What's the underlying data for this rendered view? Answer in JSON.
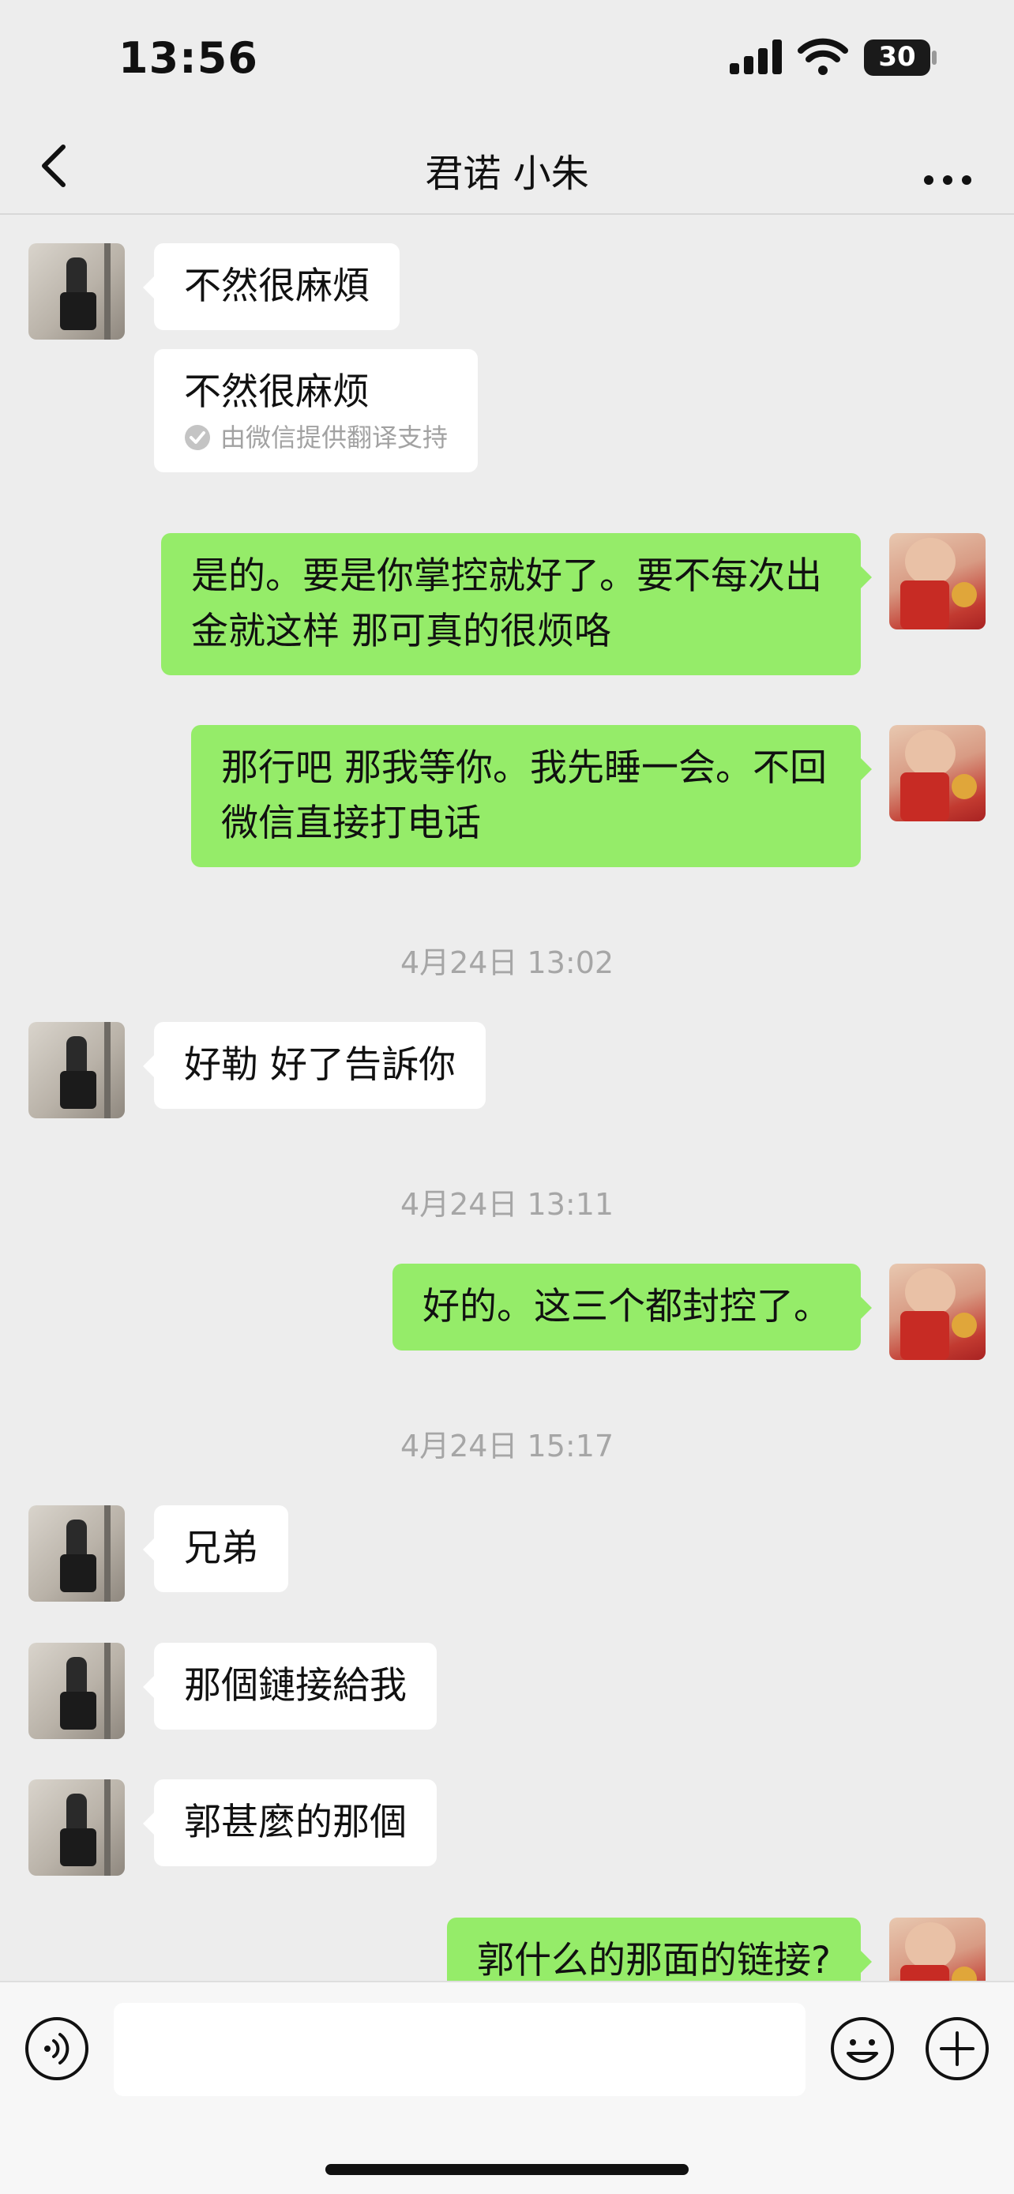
{
  "status_bar": {
    "time": "13:56",
    "battery": "30"
  },
  "header": {
    "title": "君诺 小朱"
  },
  "messages": [
    {
      "side": "left",
      "text": "不然很麻煩"
    },
    {
      "side": "left",
      "text": "不然很麻烦",
      "note": "由微信提供翻译支持"
    },
    {
      "side": "right",
      "text": "是的。要是你掌控就好了。要不每次出金就这样 那可真的很烦咯"
    },
    {
      "side": "right",
      "text": "那行吧 那我等你。我先睡一会。不回微信直接打电话"
    },
    {
      "type": "time",
      "text": "4月24日 13:02"
    },
    {
      "side": "left",
      "text": "好勒 好了告訴你"
    },
    {
      "type": "time",
      "text": "4月24日 13:11"
    },
    {
      "side": "right",
      "text": "好的。这三个都封控了。"
    },
    {
      "type": "time",
      "text": "4月24日 15:17"
    },
    {
      "side": "left",
      "text": "兄弟"
    },
    {
      "side": "left",
      "text": "那個鏈接給我"
    },
    {
      "side": "left",
      "text": "郭甚麼的那個"
    },
    {
      "side": "right",
      "text": "郭什么的那面的链接?"
    }
  ],
  "input": {
    "placeholder": ""
  },
  "icons": {
    "back": "chevron-left-icon",
    "more": "more-icon",
    "voice": "voice-icon",
    "emoji": "emoji-icon",
    "plus": "plus-icon",
    "translate": "check-circle-icon"
  },
  "colors": {
    "background": "#ededed",
    "bubble_green": "#95ec69",
    "bubble_white": "#ffffff",
    "timestamp": "#a6a6a6"
  }
}
